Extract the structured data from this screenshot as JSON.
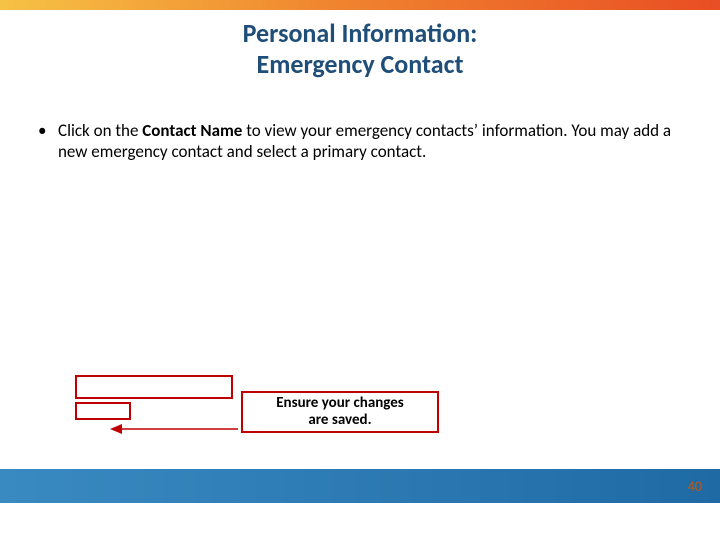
{
  "title_line1": "Personal Information:",
  "title_line2": "Emergency Contact",
  "bullet": {
    "prefix": "Click on the ",
    "bold": "Contact Name",
    "suffix": " to view your emergency contacts’ information. You may add a new emergency contact and select a primary contact."
  },
  "callout_line1": "Ensure your changes",
  "callout_line2": "are saved.",
  "page_number": "40"
}
